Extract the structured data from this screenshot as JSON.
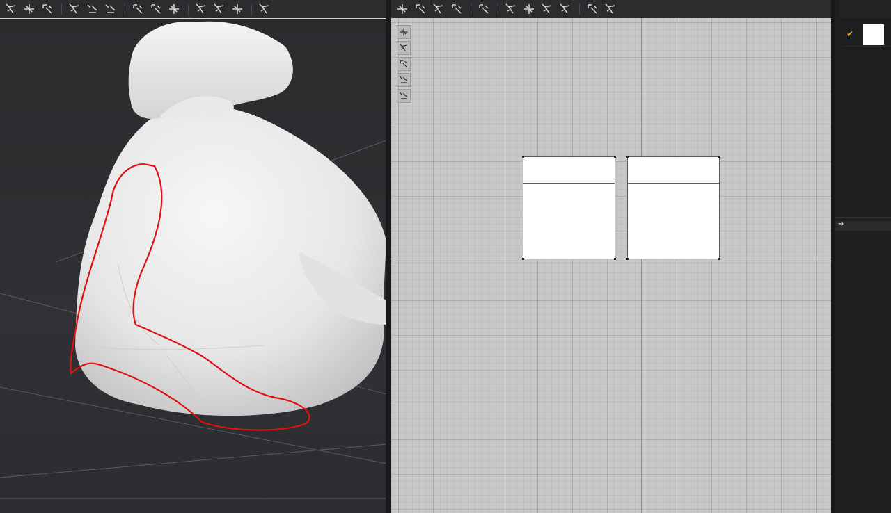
{
  "toolbar_left": {
    "groups": [
      [
        "select-mesh-icon",
        "edit-pattern-icon",
        "transform-icon"
      ],
      [
        "fold-arrange-icon",
        "tack-icon",
        "pin-icon"
      ],
      [
        "point-add-icon",
        "button-icon",
        "lock-icon"
      ],
      [
        "avatar-measure-icon",
        "flatten-icon",
        "edge-icon"
      ],
      [
        "gizmo-move-icon"
      ]
    ]
  },
  "toolbar_right": {
    "groups": [
      [
        "segment-sewing-icon",
        "free-sewing-icon",
        "m-n-sewing-icon",
        "check-sewing-icon"
      ],
      [
        "iron-icon"
      ],
      [
        "garment-fit-icon",
        "fold-icon",
        "tack-2d-icon",
        "pin-2d-icon"
      ],
      [
        "line-icon",
        "ruler-icon"
      ]
    ]
  },
  "side_tools": [
    "needle-icon",
    "shirt-icon",
    "info-icon",
    "fabric-icon",
    "lock-layer-icon"
  ],
  "colors": {
    "annotation": "#e01010",
    "seam": "#1a8a2c",
    "accent": "#e6a817"
  },
  "right_panel": {
    "selected_check": "✔",
    "swatch_color": "#ffffff",
    "expand_arrow": "➜"
  }
}
